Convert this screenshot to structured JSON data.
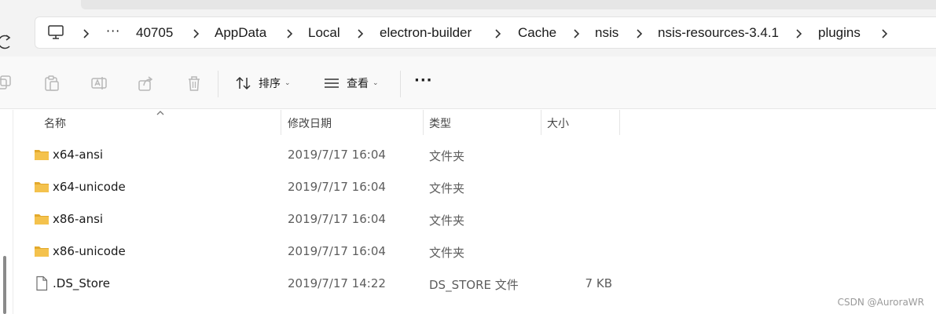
{
  "address": {
    "overflow_glyph": "···",
    "crumbs": [
      "40705",
      "AppData",
      "Local",
      "electron-builder",
      "Cache",
      "nsis",
      "nsis-resources-3.4.1",
      "plugins"
    ]
  },
  "toolbar": {
    "sort_label": "排序",
    "view_label": "查看",
    "more_glyph": "···"
  },
  "columns": {
    "name": "名称",
    "modified": "修改日期",
    "type": "类型",
    "size": "大小"
  },
  "files": [
    {
      "name": "x64-ansi",
      "modified": "2019/7/17 16:04",
      "type": "文件夹",
      "size": "",
      "icon": "folder-icon"
    },
    {
      "name": "x64-unicode",
      "modified": "2019/7/17 16:04",
      "type": "文件夹",
      "size": "",
      "icon": "folder-icon"
    },
    {
      "name": "x86-ansi",
      "modified": "2019/7/17 16:04",
      "type": "文件夹",
      "size": "",
      "icon": "folder-icon"
    },
    {
      "name": "x86-unicode",
      "modified": "2019/7/17 16:04",
      "type": "文件夹",
      "size": "",
      "icon": "folder-icon"
    },
    {
      "name": ".DS_Store",
      "modified": "2019/7/17 14:22",
      "type": "DS_STORE 文件",
      "size": "7 KB",
      "icon": "file-icon"
    }
  ],
  "watermark": "CSDN @AuroraWR",
  "colors": {
    "folder": "#f4c24d",
    "folder_dark": "#e3a92c",
    "icon_disabled": "#b8b8b8"
  }
}
